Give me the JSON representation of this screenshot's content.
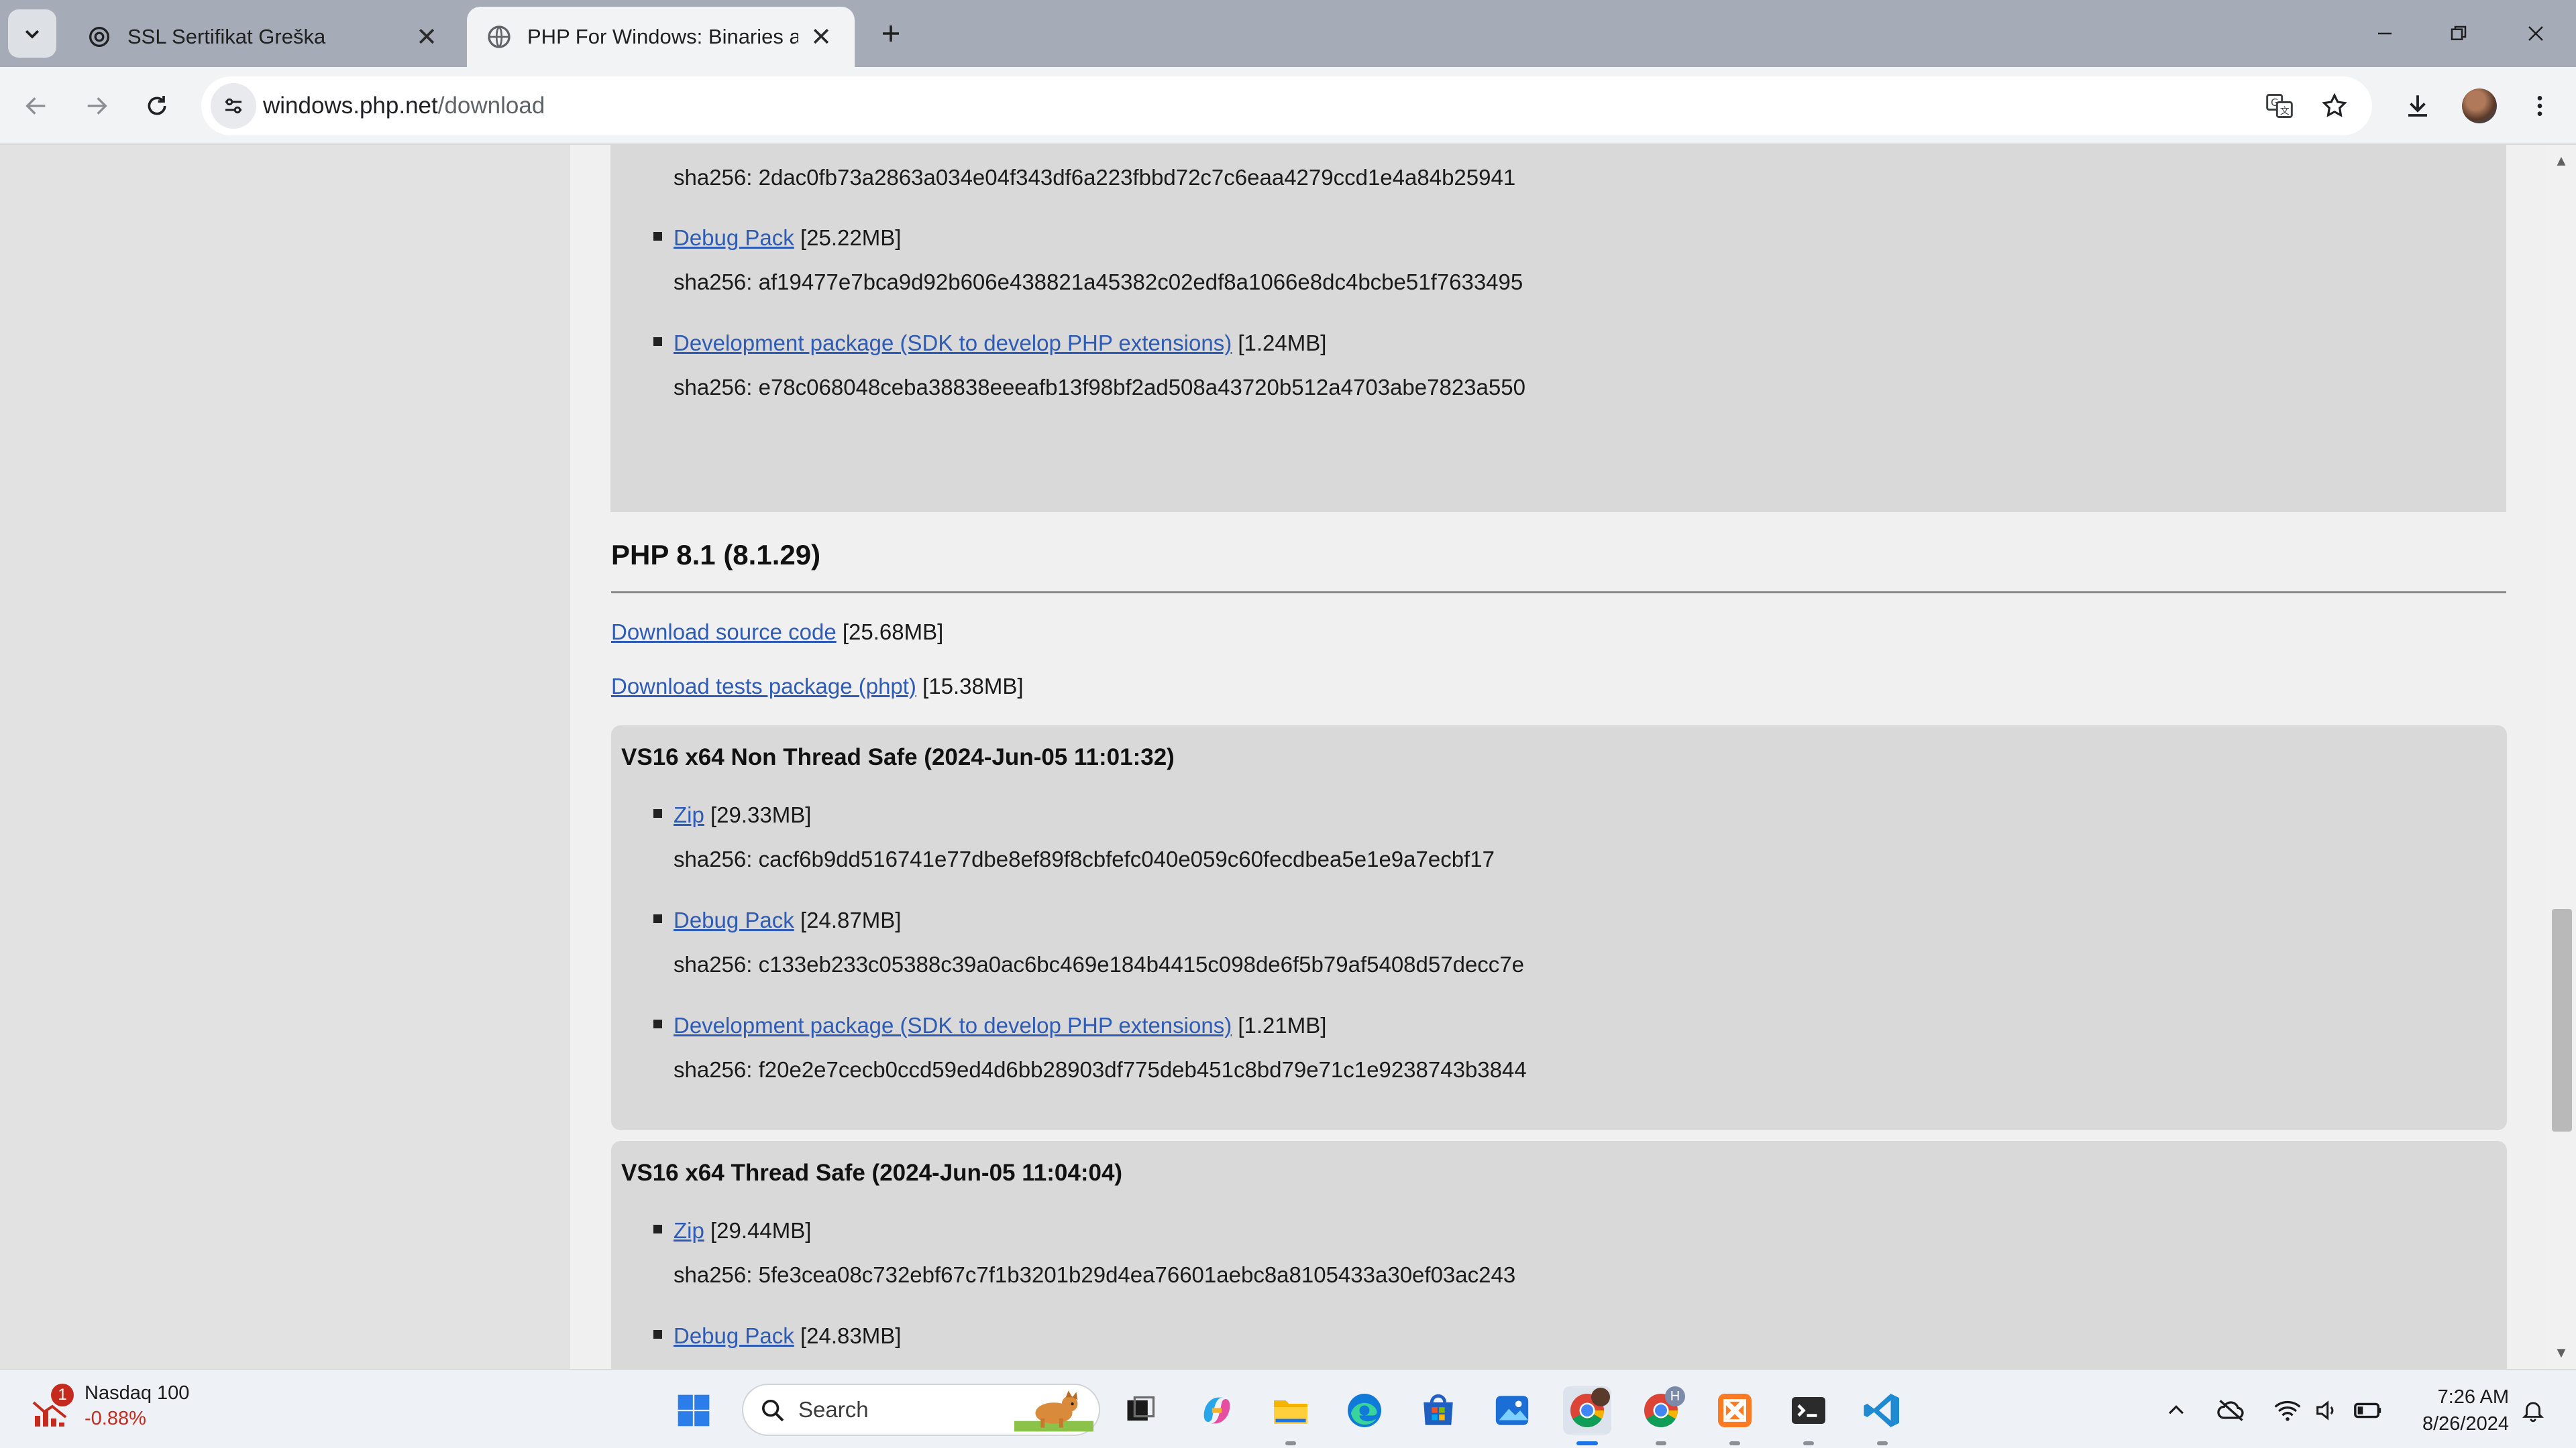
{
  "browser": {
    "tabs": [
      {
        "label": "SSL Sertifikat Greška",
        "active": false
      },
      {
        "label": "PHP For Windows: Binaries and",
        "active": true
      }
    ],
    "url_host": "windows.php.net",
    "url_path": "/download"
  },
  "page": {
    "prev_block": {
      "zip_sha": "sha256: 2dac0fb73a2863a034e04f343df6a223fbbd72c7c6eaa4279ccd1e4a84b25941",
      "debug_link": "Debug Pack",
      "debug_size": "[25.22MB]",
      "debug_sha": "sha256: af19477e7bca9d92b606e438821a45382c02edf8a1066e8dc4bcbe51f7633495",
      "dev_link": "Development package (SDK to develop PHP extensions)",
      "dev_size": "[1.24MB]",
      "dev_sha": "sha256: e78c068048ceba38838eeeafb13f98bf2ad508a43720b512a4703abe7823a550"
    },
    "version_title": "PHP 8.1 (8.1.29)",
    "source_link": "Download source code",
    "source_size": "[25.68MB]",
    "tests_link": "Download tests package (phpt)",
    "tests_size": "[15.38MB]",
    "builds": [
      {
        "title": "VS16 x64 Non Thread Safe (2024-Jun-05 11:01:32)",
        "zip_link": "Zip",
        "zip_size": "[29.33MB]",
        "zip_sha": "sha256: cacf6b9dd516741e77dbe8ef89f8cbfefc040e059c60fecdbea5e1e9a7ecbf17",
        "debug_link": "Debug Pack",
        "debug_size": "[24.87MB]",
        "debug_sha": "sha256: c133eb233c05388c39a0ac6bc469e184b4415c098de6f5b79af5408d57decc7e",
        "dev_link": "Development package (SDK to develop PHP extensions)",
        "dev_size": "[1.21MB]",
        "dev_sha": "sha256: f20e2e7cecb0ccd59ed4d6bb28903df775deb451c8bd79e71c1e9238743b3844"
      },
      {
        "title": "VS16 x64 Thread Safe (2024-Jun-05 11:04:04)",
        "zip_link": "Zip",
        "zip_size": "[29.44MB]",
        "zip_sha": "sha256: 5fe3cea08c732ebf67c7f1b3201b29d4ea76601aebc8a8105433a30ef03ac243",
        "debug_link": "Debug Pack",
        "debug_size": "[24.83MB]"
      }
    ]
  },
  "taskbar": {
    "widget_title": "Nasdaq 100",
    "widget_value": "-0.88%",
    "widget_badge": "1",
    "search_placeholder": "Search",
    "time": "7:26 AM",
    "date": "8/26/2024",
    "chrome_badge": "H"
  },
  "colors": {
    "link": "#2e5bb5",
    "tab_strip": "#a5acb8",
    "card_bg": "#f0f0f0",
    "block_bg": "#d9d9d9"
  }
}
